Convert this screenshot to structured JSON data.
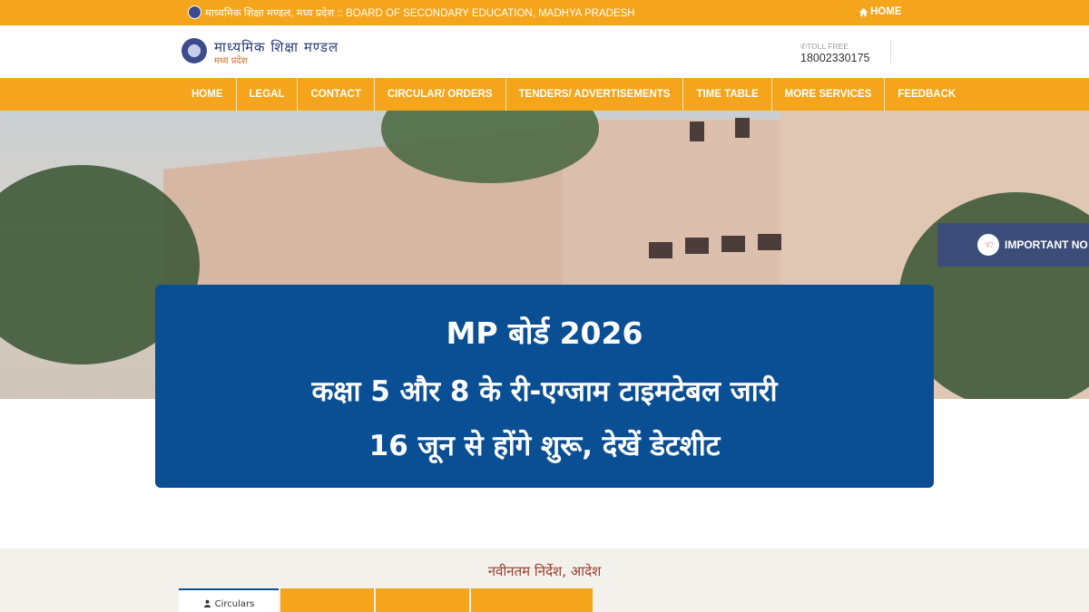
{
  "topbar": {
    "title": "माध्यमिक शिक्षा मण्डल, मध्य प्रदेश :: BOARD OF SECONDARY EDUCATION, MADHYA PRADESH",
    "home_label": "HOME",
    "home_icon": "home-icon"
  },
  "header": {
    "brand": "माध्यमिक शिक्षा मण्डल",
    "brand_sub": "मध्य प्रदेश",
    "tollfree_label": "TOLL FREE",
    "phone": "18002330175"
  },
  "nav": {
    "items": [
      "HOME",
      "LEGAL",
      "CONTACT",
      "CIRCULAR/ ORDERS",
      "TENDERS/ ADVERTISEMENTS",
      "TIME TABLE",
      "MORE SERVICES",
      "FEEDBACK"
    ]
  },
  "notice": {
    "label": "IMPORTANT NO",
    "icon": "hand-pointing-icon"
  },
  "headline": {
    "line1": "MP बोर्ड 2026",
    "line2": "कक्षा 5 और 8 के री-एग्जाम टाइमटेबल जारी",
    "line3": "16 जून से होंगे शुरू, देखें डेटशीट"
  },
  "section": {
    "title": "नवीनतम निर्देश, आदेश",
    "tabs": [
      "Circulars"
    ]
  },
  "colors": {
    "accent": "#f4a51c",
    "headline_bg": "#0a4f93",
    "notice_bg": "#3d4d7a"
  }
}
